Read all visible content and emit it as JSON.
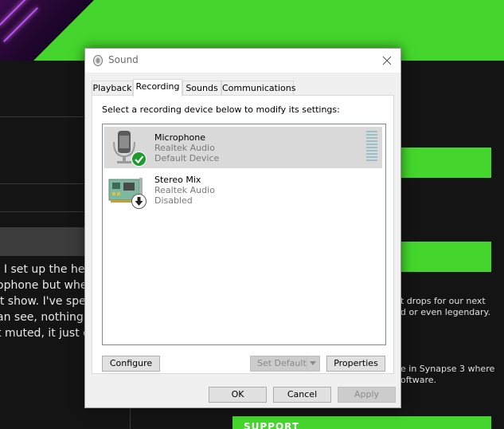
{
  "background": {
    "text_lines": [
      ", I set up the hea",
      "ophone but when",
      "'t show. I've spe",
      "an see, nothing",
      "t muted, it just d"
    ],
    "right_text_1": [
      "t drops for our next",
      "d or even legendary."
    ],
    "right_text_2": [
      "e in Synapse 3 where",
      "oftware."
    ],
    "support_label": "SUPPORT"
  },
  "dialog": {
    "title": "Sound",
    "tabs": [
      {
        "label": "Playback"
      },
      {
        "label": "Recording"
      },
      {
        "label": "Sounds"
      },
      {
        "label": "Communications"
      }
    ],
    "active_tab": "Recording",
    "instruction": "Select a recording device below to modify its settings:",
    "devices": [
      {
        "name": "Microphone",
        "driver": "Realtek Audio",
        "status": "Default Device",
        "icon": "microphone-icon",
        "badge": "default-check-icon",
        "selected": true
      },
      {
        "name": "Stereo Mix",
        "driver": "Realtek Audio",
        "status": "Disabled",
        "icon": "sound-card-icon",
        "badge": "disabled-arrow-icon",
        "selected": false
      }
    ],
    "buttons": {
      "configure": "Configure",
      "set_default": "Set Default",
      "properties": "Properties",
      "ok": "OK",
      "cancel": "Cancel",
      "apply": "Apply"
    }
  },
  "colors": {
    "accent_green": "#44d62c",
    "check_green": "#1e9a2e",
    "selection": "#d9d9d9"
  }
}
